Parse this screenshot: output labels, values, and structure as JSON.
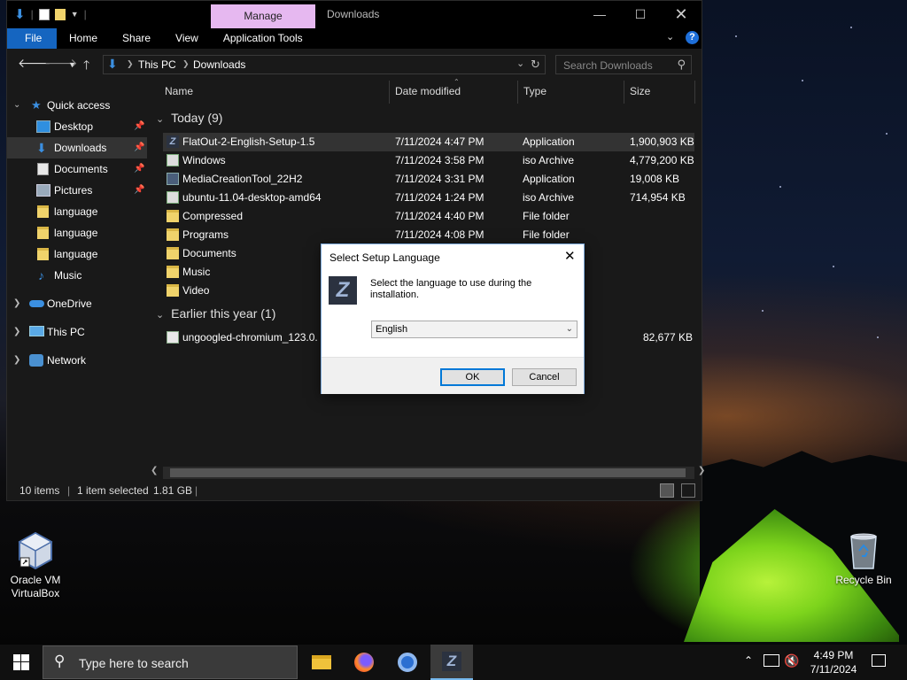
{
  "desktop": {
    "icons": [
      {
        "label_line1": "Oracle VM",
        "label_line2": "VirtualBox"
      },
      {
        "label_line1": "Recycle Bin"
      }
    ]
  },
  "explorer": {
    "title": "Downloads",
    "context_tab": "Manage",
    "ribbon_tabs": [
      "File",
      "Home",
      "Share",
      "View",
      "Application Tools"
    ],
    "address": {
      "segments": [
        "This PC",
        "Downloads"
      ]
    },
    "search_placeholder": "Search Downloads",
    "sidebar": [
      {
        "label": "Quick access"
      },
      {
        "label": "Desktop"
      },
      {
        "label": "Downloads"
      },
      {
        "label": "Documents"
      },
      {
        "label": "Pictures"
      },
      {
        "label": "language"
      },
      {
        "label": "language"
      },
      {
        "label": "language"
      },
      {
        "label": "Music"
      },
      {
        "label": "OneDrive"
      },
      {
        "label": "This PC"
      },
      {
        "label": "Network"
      }
    ],
    "columns": [
      "Name",
      "Date modified",
      "Type",
      "Size"
    ],
    "groups": [
      {
        "title": "Today (9)",
        "rows": [
          {
            "name": "FlatOut-2-English-Setup-1.5",
            "date": "7/11/2024 4:47 PM",
            "type": "Application",
            "size": "1,900,903 KB",
            "icon": "setup-app-icon"
          },
          {
            "name": "Windows",
            "date": "7/11/2024 3:58 PM",
            "type": "iso Archive",
            "size": "4,779,200 KB",
            "icon": "iso-archive-icon"
          },
          {
            "name": "MediaCreationTool_22H2",
            "date": "7/11/2024 3:31 PM",
            "type": "Application",
            "size": "19,008 KB",
            "icon": "application-icon"
          },
          {
            "name": "ubuntu-11.04-desktop-amd64",
            "date": "7/11/2024 1:24 PM",
            "type": "iso Archive",
            "size": "714,954 KB",
            "icon": "iso-archive-icon"
          },
          {
            "name": "Compressed",
            "date": "7/11/2024 4:40 PM",
            "type": "File folder",
            "size": "",
            "icon": "folder-icon"
          },
          {
            "name": "Programs",
            "date": "7/11/2024 4:08 PM",
            "type": "File folder",
            "size": "",
            "icon": "folder-icon"
          },
          {
            "name": "Documents",
            "date": "",
            "type": "",
            "size": "",
            "icon": "folder-icon"
          },
          {
            "name": "Music",
            "date": "",
            "type": "",
            "size": "",
            "icon": "folder-icon"
          },
          {
            "name": "Video",
            "date": "",
            "type": "",
            "size": "",
            "icon": "folder-icon"
          }
        ]
      },
      {
        "title": "Earlier this year (1)",
        "rows": [
          {
            "name": "ungoogled-chromium_123.0.",
            "date": "",
            "type": "",
            "size": "82,677 KB",
            "icon": "installer-icon"
          }
        ]
      }
    ],
    "status": {
      "items": "10 items",
      "selected": "1 item selected",
      "size": "1.81 GB"
    }
  },
  "dialog": {
    "title": "Select Setup Language",
    "message": "Select the language to use during the installation.",
    "selected_language": "English",
    "ok_label": "OK",
    "cancel_label": "Cancel"
  },
  "taskbar": {
    "search_placeholder": "Type here to search",
    "apps": [
      "file-explorer",
      "firefox",
      "chromium",
      "setup-app"
    ],
    "clock_time": "4:49 PM",
    "clock_date": "7/11/2024"
  },
  "colors": {
    "explorer_bg": "#191919",
    "manage_tab": "#e6b8f0",
    "file_tab": "#1565c0",
    "dialog_default_border": "#0078d7"
  }
}
